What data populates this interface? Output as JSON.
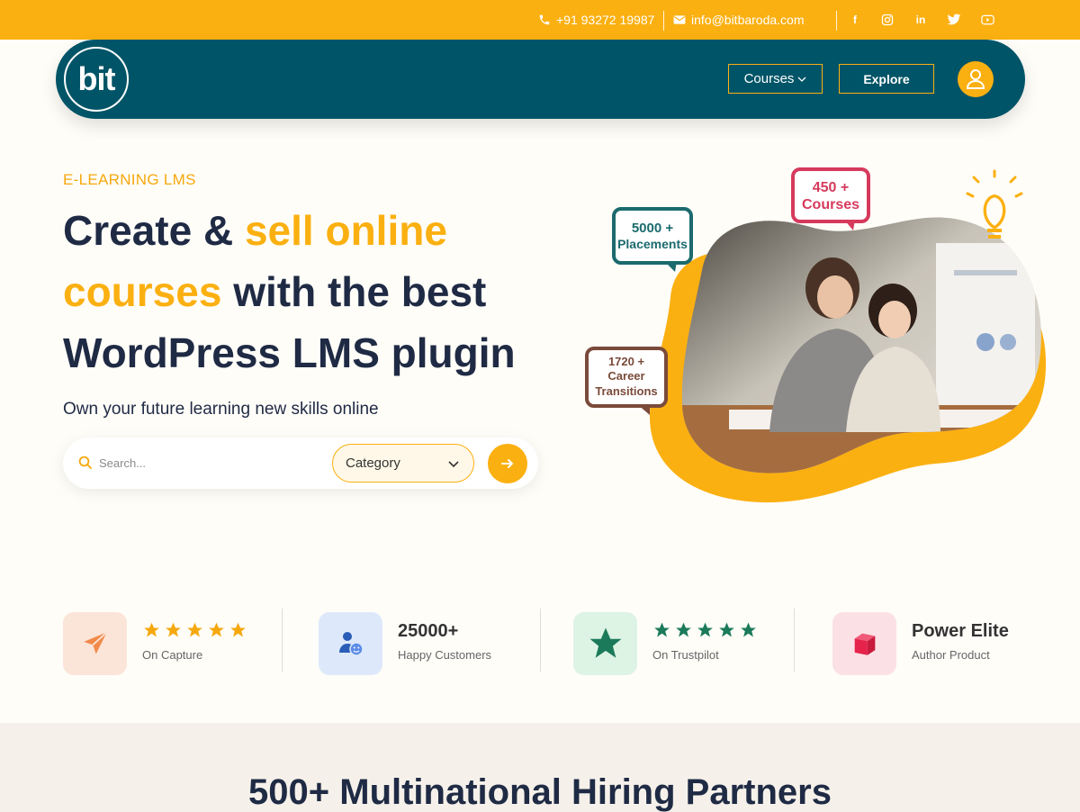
{
  "topbar": {
    "phone": "+91 93272 19987",
    "email": "info@bitbaroda.com",
    "social_icons": [
      "facebook-icon",
      "instagram-icon",
      "linkedin-icon",
      "twitter-icon",
      "youtube-icon"
    ]
  },
  "header": {
    "logo_text": "bit",
    "courses_label": "Courses",
    "explore_label": "Explore"
  },
  "hero": {
    "eyebrow": "E-LEARNING LMS",
    "headline_part1": "Create & ",
    "headline_highlight": "sell online courses",
    "headline_part2": " with the best WordPress LMS plugin",
    "subline": "Own your future learning new skills online",
    "search_placeholder": "Search...",
    "category_label": "Category",
    "badges": {
      "placements_value": "5000 +",
      "placements_label": "Placements",
      "courses_value": "450 +",
      "courses_label": "Courses",
      "transitions_value": "1720 +",
      "transitions_label_1": "Career",
      "transitions_label_2": "Transitions"
    }
  },
  "stats": [
    {
      "icon": "paper-plane-icon",
      "rating": 5,
      "subtitle": "On Capture"
    },
    {
      "icon": "users-icon",
      "title": "25000+",
      "subtitle": "Happy Customers"
    },
    {
      "icon": "trustpilot-star-icon",
      "rating": 5,
      "subtitle": "On Trustpilot"
    },
    {
      "icon": "box-icon",
      "title": "Power Elite",
      "subtitle": "Author Product"
    }
  ],
  "partners": {
    "title": "500+ Multinational Hiring Partners"
  },
  "colors": {
    "brand_yellow": "#fbb011",
    "brand_teal": "#005467",
    "navy": "#1f2a44",
    "trustpilot_green": "#1b7a5a",
    "badge_red": "#d63a5c",
    "badge_teal": "#1b6a6e",
    "badge_brown": "#7a4a3a"
  }
}
